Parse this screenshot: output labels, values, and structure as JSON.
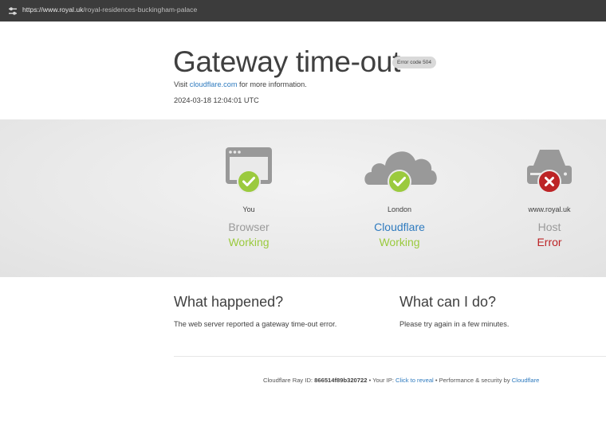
{
  "browser": {
    "url_host": "https://www.royal.uk",
    "url_path": "/royal-residences-buckingham-palace"
  },
  "header": {
    "title": "Gateway time-out",
    "error_badge": "Error code 504",
    "visit_prefix": "Visit ",
    "visit_link": "cloudflare.com",
    "visit_suffix": " for more information.",
    "timestamp": "2024-03-18 12:04:01 UTC"
  },
  "nodes": [
    {
      "location": "You",
      "name": "Browser",
      "status": "Working",
      "state": "ok"
    },
    {
      "location": "London",
      "name": "Cloudflare",
      "status": "Working",
      "state": "ok"
    },
    {
      "location": "www.royal.uk",
      "name": "Host",
      "status": "Error",
      "state": "error"
    }
  ],
  "info": {
    "what_happened_title": "What happened?",
    "what_happened_text": "The web server reported a gateway time-out error.",
    "what_can_i_do_title": "What can I do?",
    "what_can_i_do_text": "Please try again in a few minutes."
  },
  "footer": {
    "ray_label": "Cloudflare Ray ID: ",
    "ray_id": "866514f89b320722",
    "sep1": " • Your IP: ",
    "reveal": "Click to reveal",
    "sep2": " • Performance & security by ",
    "by_link": "Cloudflare"
  },
  "colors": {
    "ok": "#9bca3e",
    "error": "#bd2426",
    "link": "#2f7bbf"
  },
  "icons": [
    "tune-icon",
    "browser-window-icon",
    "cloud-icon",
    "server-icon",
    "check-icon",
    "x-icon"
  ]
}
